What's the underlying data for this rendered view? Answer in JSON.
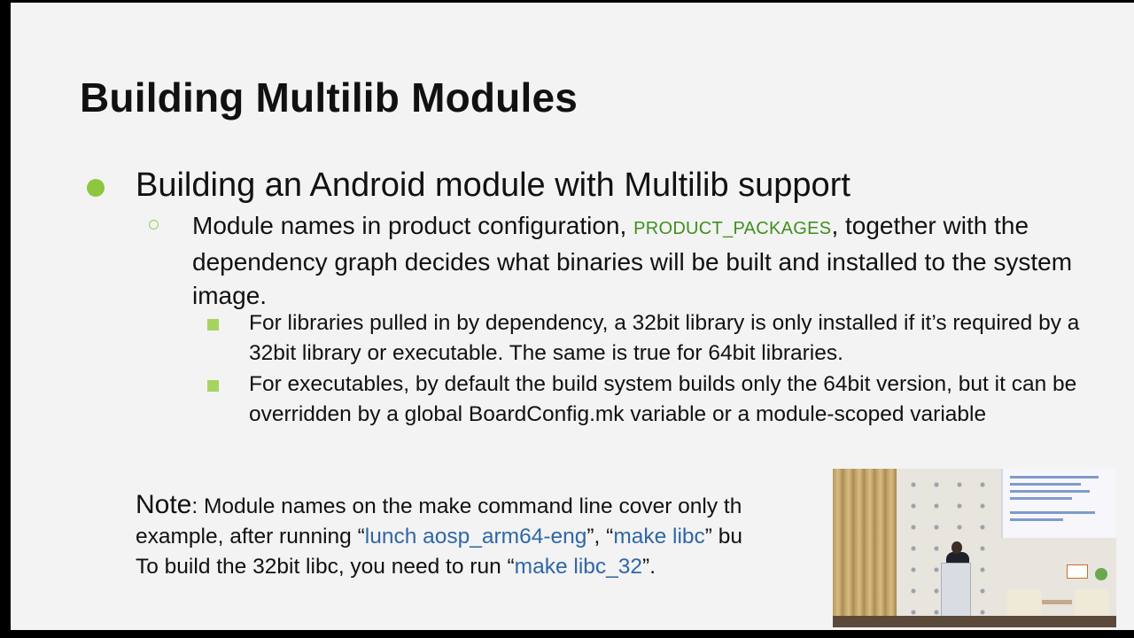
{
  "slide": {
    "title": "Building Multilib Modules",
    "bullet1": "Building an Android module with Multilib support",
    "sub1": {
      "before_code": "Module names in product configuration, ",
      "code": "PRODUCT_PACKAGES",
      "after_code": ", together with the dependency graph decides what binaries will be built and installed to the system image."
    },
    "sub_sub": [
      "For libraries pulled in by dependency, a 32bit library is only installed if it’s required by a 32bit library or executable. The same is true for 64bit libraries.",
      "For executables, by default the build system builds only the 64bit version, but it can be overridden by a global BoardConfig.mk variable or a module-scoped variable"
    ],
    "note": {
      "label": "Note",
      "line1": ": Module names on the make command line cover only th",
      "line2_before": "example, after running “",
      "cmd1": "lunch aosp_arm64-eng",
      "line2_mid": "”, “",
      "cmd2": "make libc",
      "line2_after": "” bu",
      "line3_before": "To build the 32bit libc, you need to run “",
      "cmd3": "make libc_32",
      "line3_after": "”."
    }
  },
  "colors": {
    "bullet_green": "#8fc640",
    "code_green": "#3f8f1f",
    "command_blue": "#2f67a6"
  },
  "icons": {
    "level1_bullet": "filled-circle",
    "level2_bullet": "hollow-circle",
    "level3_bullet": "filled-square"
  }
}
